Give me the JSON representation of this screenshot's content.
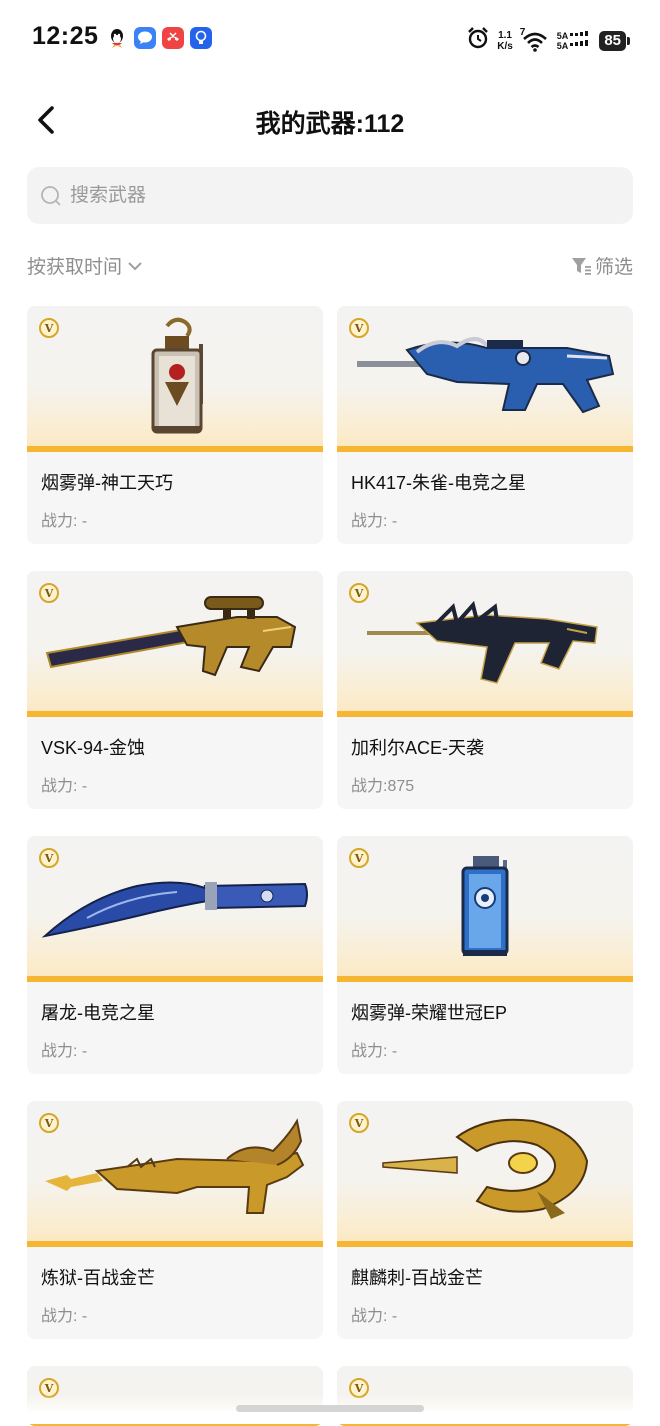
{
  "status_bar": {
    "time": "12:25",
    "net_speed_top": "1.1",
    "net_speed_unit": "K/s",
    "wifi_label": "7",
    "sim1": "5A",
    "sim2": "5A",
    "battery": "85",
    "icons": [
      "qq-icon",
      "message-app-icon",
      "missed-call-icon",
      "bulb-app-icon",
      "alarm-icon",
      "wifi-icon",
      "signal-icon",
      "battery-icon"
    ]
  },
  "header": {
    "title": "我的武器:112",
    "back_icon": "chevron-left-icon"
  },
  "search": {
    "placeholder": "搜索武器",
    "value": ""
  },
  "sort": {
    "label": "按获取时间",
    "icon": "chevron-down-icon"
  },
  "filter": {
    "label": "筛选",
    "icon": "funnel-icon"
  },
  "colors": {
    "accent_orange": "#f7b632",
    "text_secondary": "#8e8e8e",
    "card_bg": "#f6f6f6"
  },
  "weapons": [
    {
      "name": "烟雾弹-神工天巧",
      "power": "战力: -",
      "icon": "grenade-icon"
    },
    {
      "name": "HK417-朱雀-电竞之星",
      "power": "战力: -",
      "icon": "rifle-icon"
    },
    {
      "name": "VSK-94-金蚀",
      "power": "战力: -",
      "icon": "sniper-rifle-icon"
    },
    {
      "name": "加利尔ACE-天袭",
      "power": "战力:875",
      "icon": "rifle-icon"
    },
    {
      "name": "屠龙-电竞之星",
      "power": "战力: -",
      "icon": "knife-icon"
    },
    {
      "name": "烟雾弹-荣耀世冠EP",
      "power": "战力: -",
      "icon": "grenade-icon"
    },
    {
      "name": "炼狱-百战金芒",
      "power": "战力: -",
      "icon": "rifle-icon"
    },
    {
      "name": "麒麟刺-百战金芒",
      "power": "战力: -",
      "icon": "melee-weapon-icon"
    }
  ]
}
